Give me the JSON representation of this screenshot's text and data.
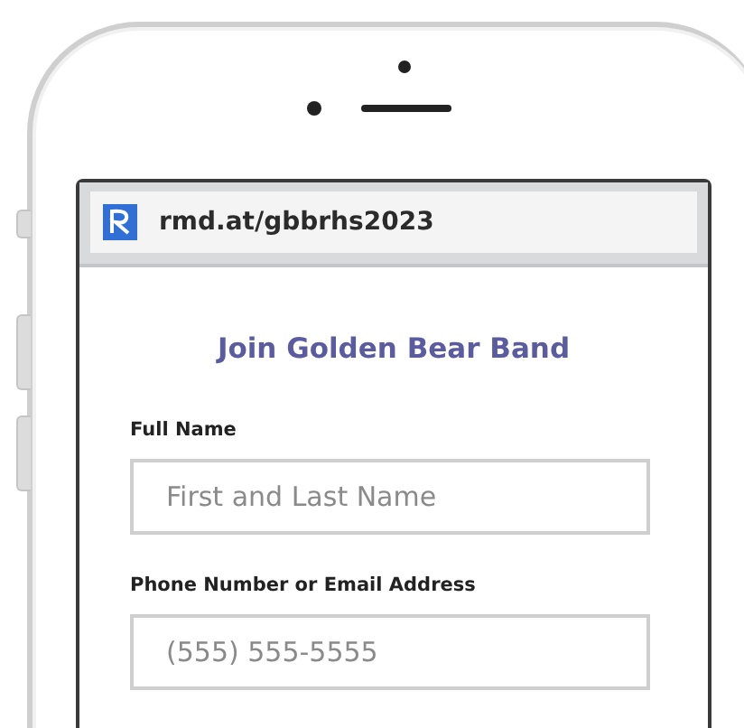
{
  "browser": {
    "url": "rmd.at/gbbrhs2023"
  },
  "form": {
    "title": "Join Golden Bear Band",
    "fields": [
      {
        "label": "Full Name",
        "placeholder": "First and Last Name"
      },
      {
        "label": "Phone Number or Email Address",
        "placeholder": "(555) 555-5555"
      }
    ]
  }
}
